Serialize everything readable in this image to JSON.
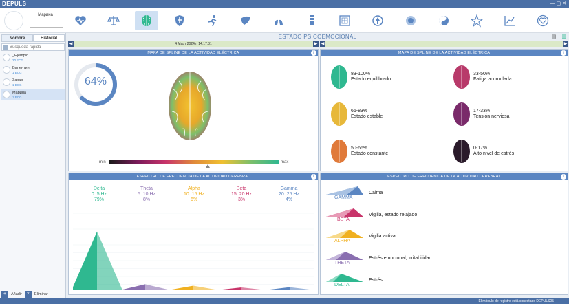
{
  "app": {
    "logo": "DEPULS",
    "window_controls": "— ▢ ✕"
  },
  "sidebar": {
    "profile_name": "Марина",
    "tabs": [
      "Nombre",
      "Historial"
    ],
    "search_placeholder": "Búsqueda rápida",
    "patients": [
      {
        "name": "_Ejemplo",
        "ecg": "20 ECG"
      },
      {
        "name": "Валентин",
        "ecg": "1 ECG"
      },
      {
        "name": "Захар",
        "ecg": "1 ECG"
      },
      {
        "name": "Марина",
        "ecg": "1 ECG"
      }
    ],
    "add_label": "Añadir",
    "delete_label": "Eliminar"
  },
  "toolbar": {
    "icons": [
      "heart-pulse-icon",
      "scales-icon",
      "brain-icon",
      "shield-icon",
      "runner-icon",
      "liver-icon",
      "lungs-icon",
      "spine-icon",
      "stomach-icon",
      "immune-icon",
      "cell-icon",
      "yin-yang-icon",
      "star-icon",
      "chart-icon",
      "heart-badge-icon"
    ],
    "active_index": 2
  },
  "page": {
    "title": "ESTADO PSICOEMOCIONAL",
    "date": "4 Март 2024 г. 14:17:31"
  },
  "left_top": {
    "title": "MAPA DE SPLINE DE LA ACTIVIDAD ELÉCTRICA",
    "percent": "64%",
    "percent_value": 0.64,
    "scale_min": "min",
    "scale_max": "max",
    "scale_marker": 0.58
  },
  "right_top": {
    "title": "MAPA DE SPLINE DE LA ACTIVIDAD ELÉCTRICA",
    "legend": [
      {
        "pct": "83-100%",
        "text": "Estado equilibrado",
        "color": "#2fb890"
      },
      {
        "pct": "33-50%",
        "text": "Fatiga acumulada",
        "color": "#b83a6a"
      },
      {
        "pct": "66-83%",
        "text": "Estado estable",
        "color": "#e7b83a"
      },
      {
        "pct": "17-33%",
        "text": "Tensión nerviosa",
        "color": "#7a2a6a"
      },
      {
        "pct": "50-66%",
        "text": "Estado constante",
        "color": "#e07a3a"
      },
      {
        "pct": "0-17%",
        "text": "Alto nivel de estrés",
        "color": "#2a1a2a"
      }
    ]
  },
  "left_bottom": {
    "title": "ESPECTRO DE FRECUENCIA DE LA ACTIVIDAD CEREBRAL",
    "bands": [
      {
        "name": "Delta",
        "range": "0..5 Hz",
        "pct": "79%",
        "value": 79,
        "color": "#2fb890"
      },
      {
        "name": "Theta",
        "range": "5..10 Hz",
        "pct": "8%",
        "value": 8,
        "color": "#8a6fb0"
      },
      {
        "name": "Alpha",
        "range": "10..15 Hz",
        "pct": "6%",
        "value": 6,
        "color": "#f0b020"
      },
      {
        "name": "Beta",
        "range": "15..20 Hz",
        "pct": "3%",
        "value": 3,
        "color": "#c8346a"
      },
      {
        "name": "Gamma",
        "range": "20..25 Hz",
        "pct": "4%",
        "value": 4,
        "color": "#5b86c2"
      }
    ]
  },
  "right_bottom": {
    "title": "ESPECTRO DE FRECUENCIA DE LA ACTIVIDAD CEREBRAL",
    "waves": [
      {
        "tag": "GAMMA",
        "text": "Calma",
        "color": "#5b86c2"
      },
      {
        "tag": "BETA",
        "text": "Vigilia, estado relajado",
        "color": "#c8346a"
      },
      {
        "tag": "ALPHA",
        "text": "Vigilia activa",
        "color": "#f0b020"
      },
      {
        "tag": "THETA",
        "text": "Estrés emocional, irritabilidad",
        "color": "#8a6fb0"
      },
      {
        "tag": "DELTA",
        "text": "Estrés",
        "color": "#2fb890"
      }
    ]
  },
  "status": {
    "message": "El módulo de registro está conectado DEPULS05"
  }
}
